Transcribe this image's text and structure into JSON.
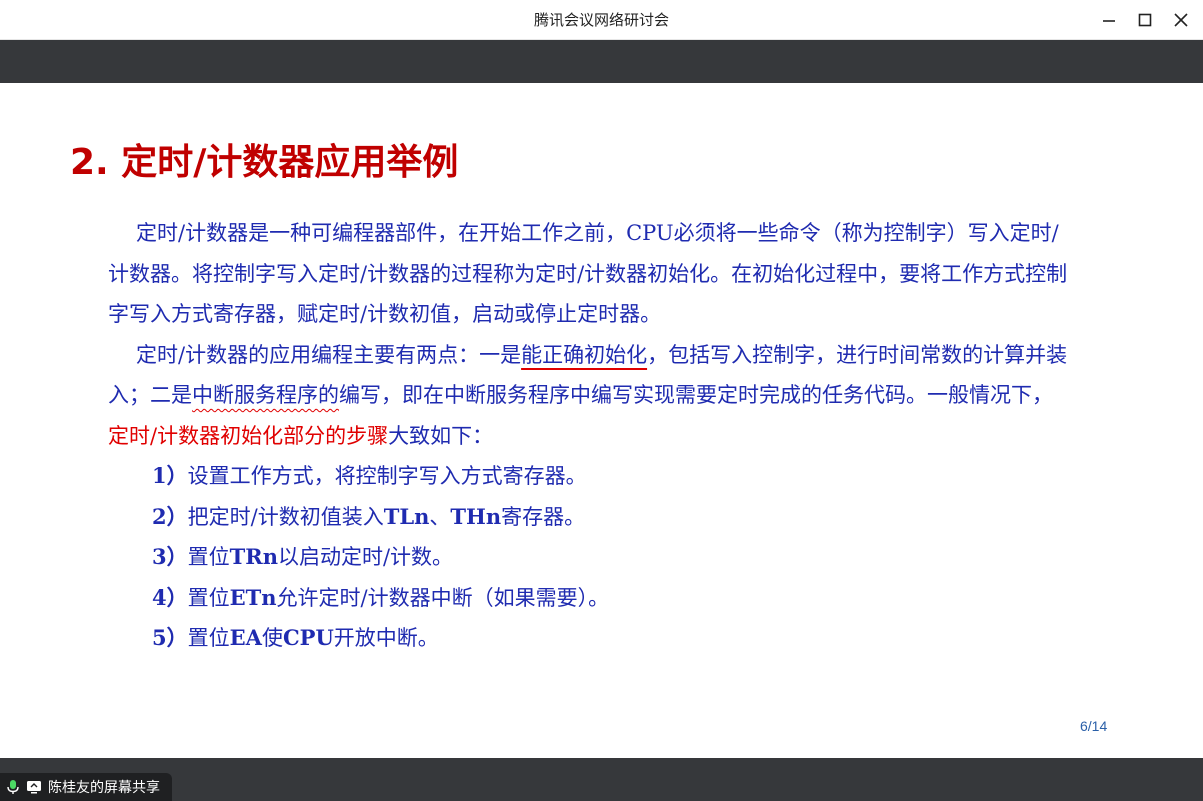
{
  "window": {
    "title": "腾讯会议网络研讨会",
    "minimize_glyph": "—",
    "maximize_glyph": "☐",
    "close_glyph": "✕"
  },
  "slide": {
    "title": "2. 定时/计数器应用举例",
    "para1": "定时/计数器是一种可编程器部件，在开始工作之前，CPU必须将一些命令（称为控制字）写入定时/计数器。将控制字写入定时/计数器的过程称为定时/计数器初始化。在初始化过程中，要将工作方式控制字写入方式寄存器，赋定时/计数初值，启动或停止定时器。",
    "para2": {
      "pre": "定时/计数器的应用编程主要有两点：一是",
      "u1": "能正确初始化",
      "mid1": "，包括写入控制字，进行时间常数的计算并装入；二是",
      "u2": "中断服务程序的",
      "mid2": "编写，即在中断服务程序中编写实现需要定时完成的任务代码。一般情况下，",
      "red": "定时/计数器初始化部分的步骤",
      "post": "大致如下："
    },
    "steps": [
      "1）设置工作方式，将控制字写入方式寄存器。",
      "2）把定时/计数初值装入TLn、THn寄存器。",
      "3）置位TRn以启动定时/计数。",
      "4）置位ETn允许定时/计数器中断（如果需要）。",
      "5）置位EA使CPU开放中断。"
    ],
    "page_number": "6/14"
  },
  "share": {
    "label": "陈桂友的屏幕共享"
  },
  "colors": {
    "title_red": "#c00000",
    "body_blue": "#1f2bb0",
    "highlight_red": "#e00000",
    "bar_dark": "#36383b"
  }
}
